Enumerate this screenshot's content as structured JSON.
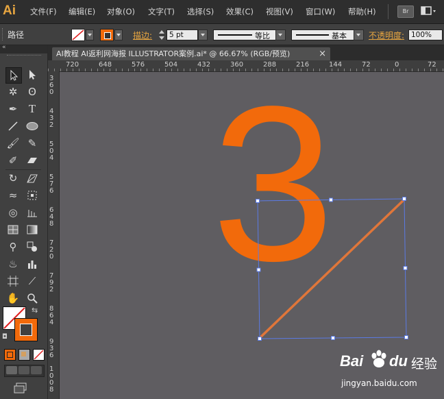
{
  "app": {
    "logo": "Ai"
  },
  "menu": [
    "文件(F)",
    "编辑(E)",
    "对象(O)",
    "文字(T)",
    "选择(S)",
    "效果(C)",
    "视图(V)",
    "窗口(W)",
    "帮助(H)"
  ],
  "menubar_right": {
    "bridge_label": "Br"
  },
  "control_bar": {
    "selection_label": "路径",
    "stroke_label": "描边:",
    "stroke_weight": "5 pt",
    "profile_label": "等比",
    "brush_label": "基本",
    "opacity_label": "不透明度:",
    "opacity_value": "100%"
  },
  "document_tab": {
    "title": "AI教程  AI返利网海报 ILLUSTRATOR案例.ai* @ 66.67% (RGB/预览)",
    "close_glyph": "×"
  },
  "ruler": {
    "h_labels": [
      "720",
      "648",
      "576",
      "504",
      "432",
      "360",
      "288",
      "216",
      "144",
      "72",
      "0",
      "72"
    ],
    "v_labels": [
      "360",
      "432",
      "504",
      "576",
      "648",
      "720",
      "792",
      "864",
      "936",
      "1008"
    ]
  },
  "canvas": {
    "numeral": "3",
    "numeral_color": "#f26a0b",
    "line_color": "#e0763a",
    "selection_color": "#5b7be6"
  },
  "tools": [
    "selection-tool",
    "direct-selection-tool",
    "magic-wand-tool",
    "lasso-tool",
    "pen-tool",
    "type-tool",
    "line-tool",
    "ellipse-tool",
    "paintbrush-tool",
    "pencil-tool",
    "blob-brush-tool",
    "eraser-tool",
    "rotate-tool",
    "scale-tool",
    "width-tool",
    "free-transform-tool",
    "shape-builder-tool",
    "graph-tool",
    "mesh-tool",
    "gradient-tool",
    "eyedropper-tool",
    "blend-tool",
    "symbol-sprayer-tool",
    "column-graph-tool",
    "artboard-tool",
    "slice-tool",
    "hand-tool",
    "zoom-tool"
  ],
  "colors": {
    "fill": "none",
    "stroke": "#f26a0b"
  },
  "watermark": {
    "brand": "Bai",
    "brand2": "du",
    "product": "经验",
    "url": "jingyan.baidu.com"
  }
}
